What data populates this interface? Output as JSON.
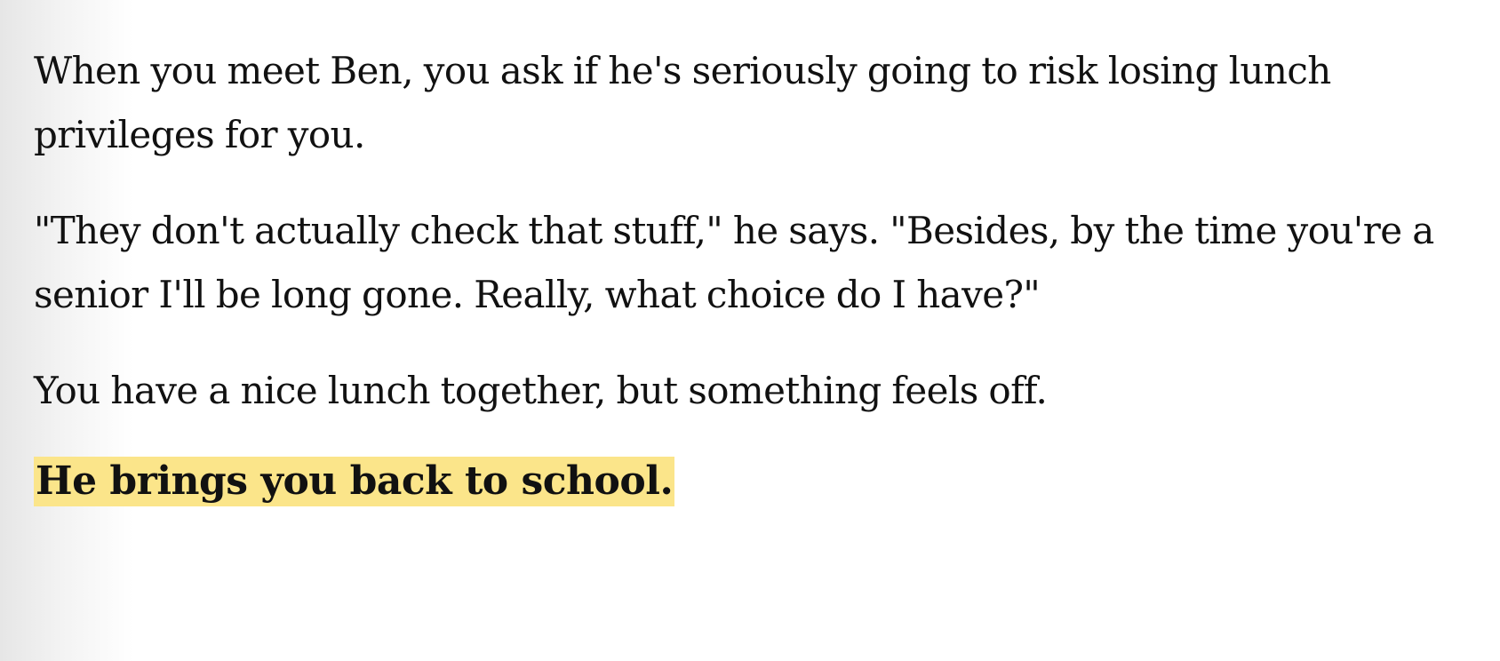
{
  "story": {
    "paragraphs": [
      "When you meet Ben, you ask if he's seriously going to risk losing lunch privileges for you.",
      "\"They don't actually check that stuff,\" he says. \"Besides, by the time you're a senior I'll be long gone. Really, what choice do I have?\"",
      "You have a nice lunch together, but something feels off."
    ],
    "choice": "He brings you back to school."
  },
  "colors": {
    "highlight": "#fbe58a",
    "text": "#111111",
    "background": "#ffffff"
  }
}
